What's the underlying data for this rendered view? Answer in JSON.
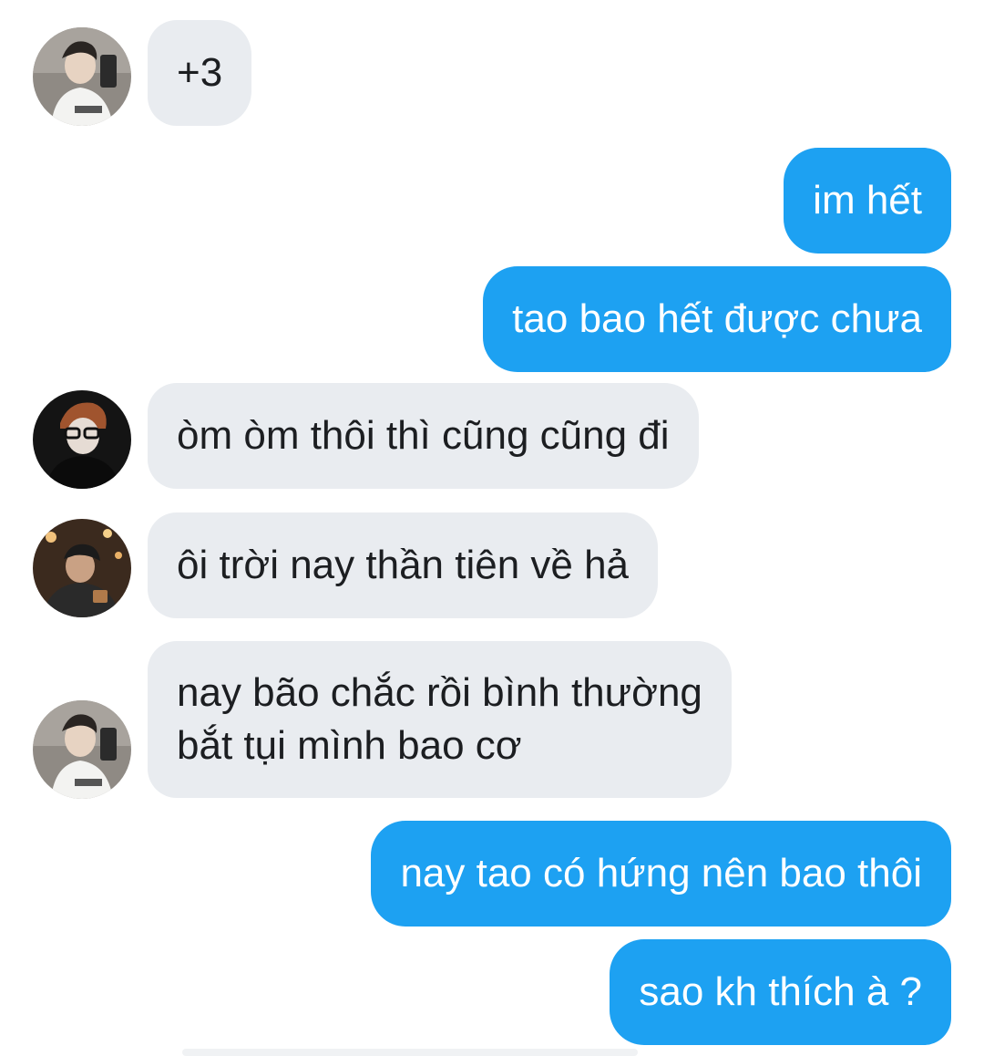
{
  "theme": {
    "incoming_bg": "#e9ecf0",
    "outgoing_bg": "#1da1f2",
    "incoming_text": "#1c1e21",
    "outgoing_text": "#ffffff"
  },
  "messages": [
    {
      "side": "in",
      "avatar": "avatar-person-1",
      "text": "+3"
    },
    {
      "side": "out",
      "text": "im hết"
    },
    {
      "side": "out",
      "text": "tao bao hết được chưa"
    },
    {
      "side": "in",
      "avatar": "avatar-person-2",
      "text": "òm òm thôi thì cũng cũng đi"
    },
    {
      "side": "in",
      "avatar": "avatar-person-3",
      "text": "ôi trời nay thần tiên về hả"
    },
    {
      "side": "in",
      "avatar": "avatar-person-1",
      "lines": [
        "nay bão chắc rồi bình thường",
        "bắt tụi mình bao cơ"
      ]
    },
    {
      "side": "out",
      "text": "nay tao có hứng nên bao thôi"
    },
    {
      "side": "out",
      "text": "sao kh thích à ?"
    }
  ]
}
